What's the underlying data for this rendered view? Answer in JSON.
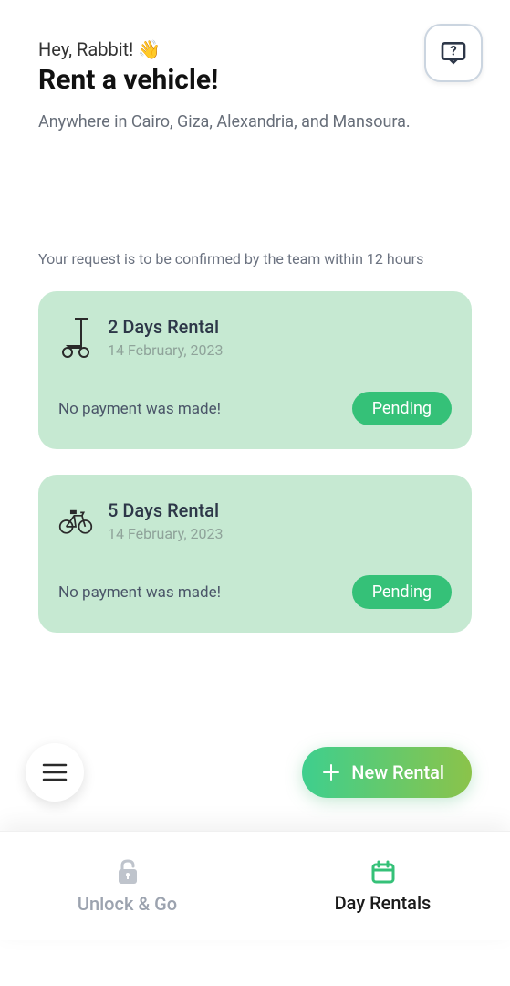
{
  "header": {
    "greeting": "Hey, Rabbit! 👋",
    "title": "Rent a vehicle!",
    "subtitle": "Anywhere in Cairo, Giza, Alexandria, and Mansoura."
  },
  "notice": "Your request is to be confirmed by the team within 12 hours",
  "rentals": [
    {
      "icon": "scooter-icon",
      "title": "2 Days Rental",
      "date": "14 February, 2023",
      "payment": "No payment was made!",
      "status": "Pending"
    },
    {
      "icon": "bicycle-icon",
      "title": "5 Days Rental",
      "date": "14 February, 2023",
      "payment": "No payment was made!",
      "status": "Pending"
    }
  ],
  "actions": {
    "new_rental": "New Rental"
  },
  "nav": {
    "unlock": "Unlock & Go",
    "day_rentals": "Day Rentals"
  },
  "colors": {
    "card_bg": "#c6e9d2",
    "accent": "#35c178",
    "gradient_start": "#3ecf8e",
    "gradient_end": "#8bc34a"
  }
}
